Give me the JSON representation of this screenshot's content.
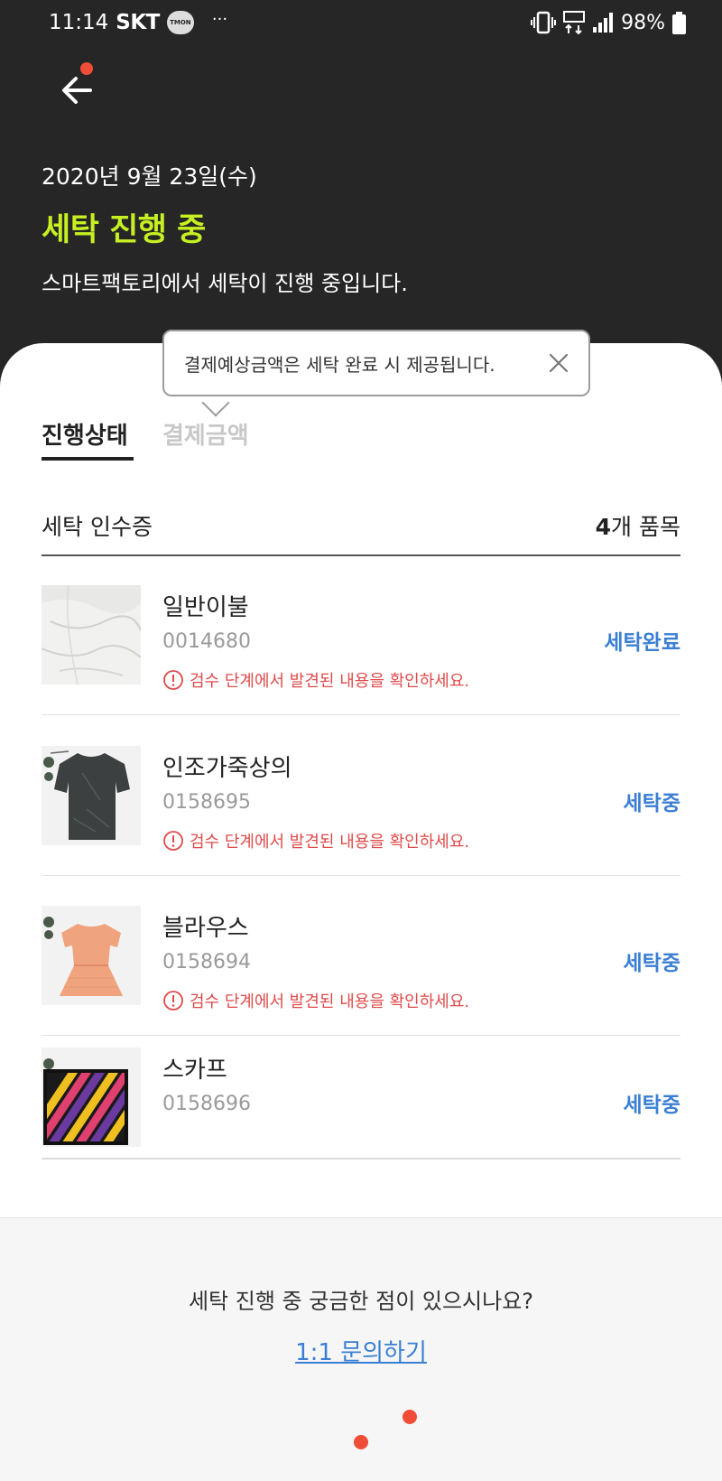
{
  "status_bar": {
    "time": "11:14",
    "carrier": "SKT",
    "badge": "TMON",
    "dots": "···",
    "battery": "98%"
  },
  "header": {
    "date": "2020년 9월 23일(수)",
    "title": "세탁 진행 중",
    "description": "스마트팩토리에서 세탁이 진행 중입니다."
  },
  "tooltip": {
    "text": "결제예상금액은 세탁 완료 시 제공됩니다."
  },
  "tabs": [
    {
      "label": "진행상태",
      "active": true
    },
    {
      "label": "결제금액",
      "active": false
    }
  ],
  "receipt": {
    "title": "세탁 인수증",
    "count_number": "4",
    "count_suffix": "개 품목"
  },
  "items": [
    {
      "name": "일반이불",
      "code": "0014680",
      "status": "세탁완료",
      "warning": "검수 단계에서 발견된 내용을 확인하세요."
    },
    {
      "name": "인조가죽상의",
      "code": "0158695",
      "status": "세탁중",
      "warning": "검수 단계에서 발견된 내용을 확인하세요."
    },
    {
      "name": "블라우스",
      "code": "0158694",
      "status": "세탁중",
      "warning": "검수 단계에서 발견된 내용을 확인하세요."
    },
    {
      "name": "스카프",
      "code": "0158696",
      "status": "세탁중",
      "warning": ""
    }
  ],
  "footer": {
    "question": "세탁 진행 중 궁금한 점이 있으시나요?",
    "link": "1:1 문의하기"
  },
  "colors": {
    "accent_lime": "#c6f022",
    "status_blue": "#3b7fd4",
    "warning_red": "#e04a4a",
    "header_bg": "#262626"
  }
}
